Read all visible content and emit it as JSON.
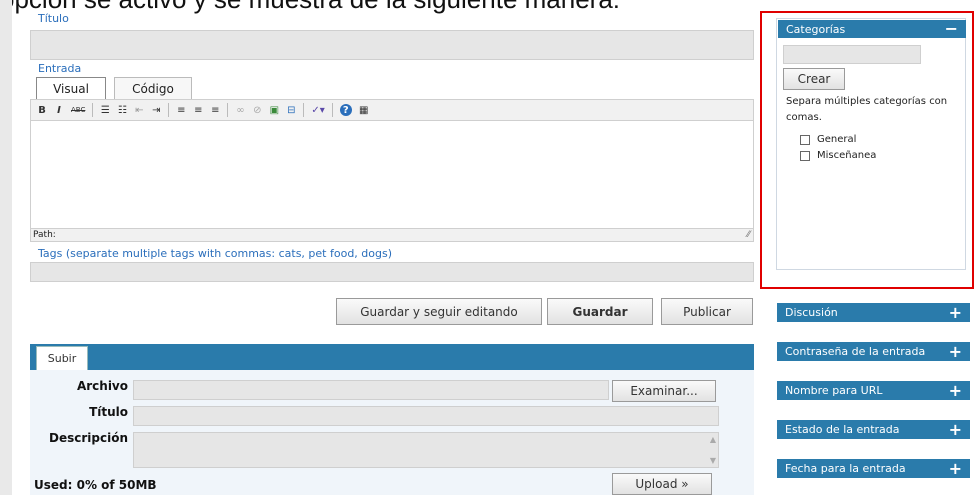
{
  "caption": "opción se activó y se muestra de la siguiente manera:",
  "editor": {
    "title_label": "Título",
    "entry_label": "Entrada",
    "tabs": [
      {
        "label": "Visual"
      },
      {
        "label": "Código"
      }
    ],
    "path_label": "Path:",
    "tags_label": "Tags (separate multiple tags with commas: cats, pet food, dogs)",
    "toolbar": [
      {
        "icon": "bold-icon",
        "glyph": "B"
      },
      {
        "icon": "italic-icon",
        "glyph": "I"
      },
      {
        "icon": "strikethrough-icon",
        "glyph": "ABC"
      },
      {
        "icon": "bulleted-list-icon",
        "glyph": "☰"
      },
      {
        "icon": "numbered-list-icon",
        "glyph": "☷"
      },
      {
        "icon": "outdent-icon",
        "glyph": "⇤"
      },
      {
        "icon": "indent-icon",
        "glyph": "⇥"
      },
      {
        "icon": "align-left-icon",
        "glyph": "≡"
      },
      {
        "icon": "align-center-icon",
        "glyph": "≡"
      },
      {
        "icon": "align-right-icon",
        "glyph": "≡"
      },
      {
        "icon": "link-icon",
        "glyph": "∞"
      },
      {
        "icon": "unlink-icon",
        "glyph": "⊘"
      },
      {
        "icon": "image-icon",
        "glyph": "▣"
      },
      {
        "icon": "more-icon",
        "glyph": "⊟"
      },
      {
        "icon": "spellcheck-icon",
        "glyph": "✓▾"
      },
      {
        "icon": "help-icon",
        "glyph": "?"
      },
      {
        "icon": "kitchen-sink-icon",
        "glyph": "▦"
      }
    ]
  },
  "actions": {
    "save_continue": "Guardar y seguir editando",
    "save": "Guardar",
    "publish": "Publicar"
  },
  "upload": {
    "tab": "Subir",
    "file_label": "Archivo",
    "browse": "Examinar...",
    "title_label": "Título",
    "description_label": "Descripción",
    "used": "Used: 0% of 50MB",
    "upload_button": "Upload »"
  },
  "categories": {
    "header": "Categorías",
    "collapse": "−",
    "create_button": "Crear",
    "help": "Separa múltiples categorías con comas.",
    "items": [
      {
        "label": "General",
        "checked": false
      },
      {
        "label": "Misceñanea",
        "checked": false
      }
    ]
  },
  "side_panels": [
    {
      "label": "Discusión"
    },
    {
      "label": "Contraseña de la entrada"
    },
    {
      "label": "Nombre para URL"
    },
    {
      "label": "Estado de la entrada"
    },
    {
      "label": "Fecha para la entrada"
    }
  ],
  "colors": {
    "accent": "#2a7bab",
    "highlight": "#e00000",
    "link": "#2a6ebb"
  }
}
